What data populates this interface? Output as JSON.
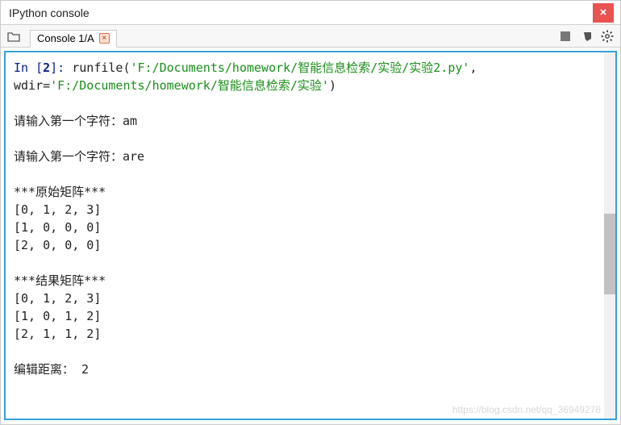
{
  "window": {
    "title": "IPython console",
    "close_glyph": "×"
  },
  "tabs": {
    "browse_icon": "folder",
    "active_label": "Console 1/A",
    "toolbar": {
      "stop_icon": "stop",
      "erase_icon": "erase",
      "settings_icon": "gear"
    }
  },
  "console": {
    "prompt_in": "In [",
    "exec_num": "2",
    "prompt_close": "]: ",
    "call": "runfile(",
    "arg1": "'F:/Documents/homework/智能信息检索/实验/实验2.py'",
    "sep": ", ",
    "lead_nl": "\n",
    "kwarg": "wdir=",
    "arg2": "'F:/Documents/homework/智能信息检索/实验'",
    "close_paren": ")",
    "body": "\n\n请输入第一个字符：am\n\n请输入第一个字符：are\n\n***原始矩阵***\n[0, 1, 2, 3]\n[1, 0, 0, 0]\n[2, 0, 0, 0]\n\n***结果矩阵***\n[0, 1, 2, 3]\n[1, 0, 1, 2]\n[2, 1, 1, 2]\n\n编辑距离： 2"
  },
  "watermark": "https://blog.csdn.net/qq_36949278"
}
